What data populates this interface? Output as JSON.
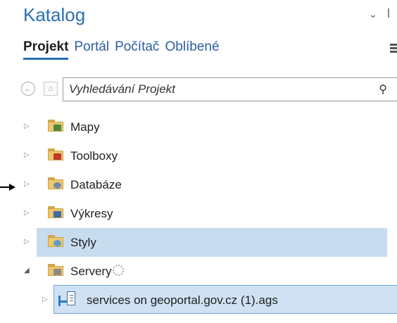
{
  "panel": {
    "title": "Katalog",
    "controls": [
      "⌄",
      "ꟾ"
    ]
  },
  "tabs": [
    {
      "label": "Projekt",
      "active": true
    },
    {
      "label": "Portál",
      "active": false
    },
    {
      "label": "Počítač",
      "active": false
    },
    {
      "label": "Oblíbené",
      "active": false
    }
  ],
  "search": {
    "placeholder": "Vyhledávání Projekt"
  },
  "tree": [
    {
      "label": "Mapy",
      "icon": "maps-folder-icon",
      "badge_color": "#4a8a3a"
    },
    {
      "label": "Toolboxy",
      "icon": "toolbox-folder-icon",
      "badge_color": "#c0392b"
    },
    {
      "label": "Databáze",
      "icon": "database-folder-icon",
      "badge_color": "#6e8ca8"
    },
    {
      "label": "Výkresy",
      "icon": "layouts-folder-icon",
      "badge_color": "#3a6fa8"
    },
    {
      "label": "Styly",
      "icon": "styles-folder-icon",
      "badge_color": "#5aa0c8",
      "selected": true
    },
    {
      "label": "Servery",
      "icon": "servers-folder-icon",
      "badge_color": "#8a8a8a",
      "expanded": true,
      "loading": true
    },
    {
      "label": "services on geoportal.gov.cz (1).ags",
      "icon": "ags-connection-icon",
      "selected": true,
      "child": true
    }
  ]
}
